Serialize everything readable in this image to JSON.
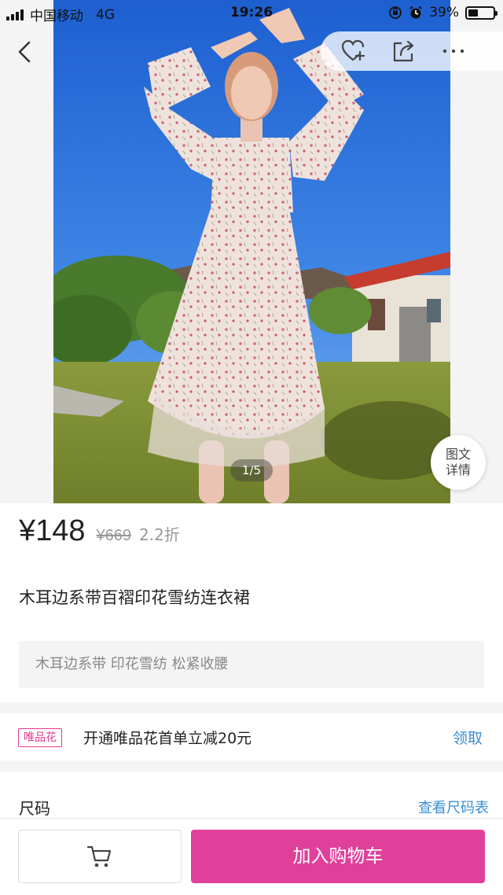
{
  "status_bar": {
    "carrier": "中国移动",
    "network": "4G",
    "time": "19:26",
    "battery": "39%",
    "battery_level": 0.39
  },
  "gallery": {
    "pager": "1/5",
    "detail_label_line1": "图文",
    "detail_label_line2": "详情"
  },
  "icons": {
    "back": "back-arrow-icon",
    "favorite": "heart-plus-icon",
    "share": "share-icon",
    "more": "more-dots-icon",
    "cart": "shopping-cart-icon"
  },
  "price": {
    "current": "¥148",
    "original": "¥669",
    "discount": "2.2折"
  },
  "product": {
    "title": "木耳边系带百褶印花雪纺连衣裙",
    "tags": "木耳边系带 印花雪纺 松紧收腰"
  },
  "promo": {
    "badge": "唯品花",
    "text": "开通唯品花首单立减20元",
    "action": "领取"
  },
  "size": {
    "label": "尺码",
    "chart_link": "查看尺码表"
  },
  "bottom_bar": {
    "add_to_cart": "加入购物车"
  },
  "colors": {
    "accent": "#e0409a",
    "link": "#3b8fd6",
    "muted": "#999999"
  }
}
